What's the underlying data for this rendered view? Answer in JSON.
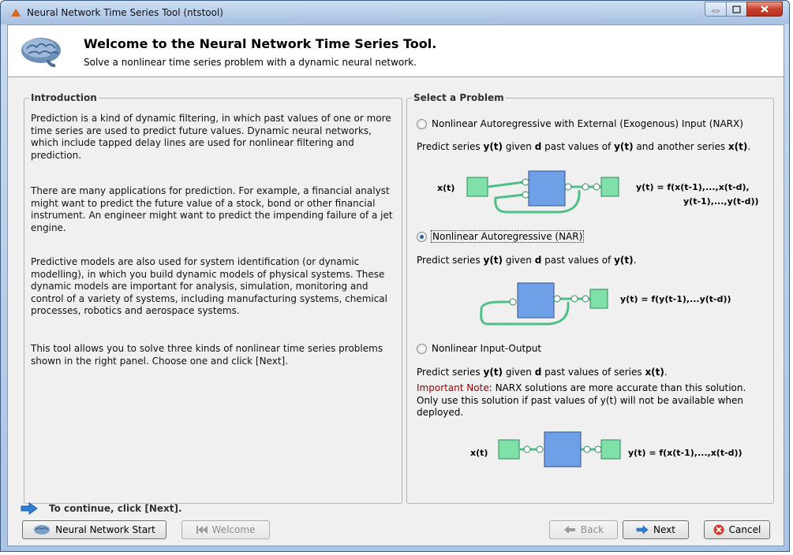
{
  "window": {
    "title": "Neural Network Time Series Tool (ntstool)"
  },
  "header": {
    "title": "Welcome to the Neural Network Time Series Tool.",
    "subtitle": "Solve a nonlinear time series problem with a dynamic neural network."
  },
  "introduction": {
    "label": "Introduction",
    "paragraphs": [
      "Prediction is a kind of dynamic filtering, in which past values of one or more time series are used to predict future values. Dynamic neural networks, which include tapped delay lines are used for nonlinear filtering and prediction.",
      "There are many applications for prediction. For example, a financial analyst might want to predict the future value of a stock, bond or other financial instrument. An engineer might want to predict the impending failure of a jet engine.",
      "Predictive models are also used for system identification (or dynamic modelling), in which you build dynamic models of physical systems. These dynamic models are important for analysis, simulation, monitoring and control of a variety of systems, including manufacturing systems, chemical processes, robotics and aerospace systems.",
      "This tool allows you to solve three kinds of nonlinear time series problems shown in the right panel. Choose one and click [Next]."
    ]
  },
  "problems": {
    "label": "Select a Problem",
    "narx": {
      "label": "Nonlinear Autoregressive with External (Exogenous) Input (NARX)",
      "selected": false,
      "pred_a": "Predict series ",
      "pred_b": "y(t)",
      "pred_c": " given ",
      "pred_d": "d",
      "pred_e": " past values of ",
      "pred_f": "y(t)",
      "pred_g": " and another series ",
      "pred_h": "x(t)",
      "pred_i": ".",
      "input": "x(t)",
      "formula_1": "y(t) = f(x(t-1),...,x(t-d),",
      "formula_2": "y(t-1),...,y(t-d))"
    },
    "nar": {
      "label": "Nonlinear Autoregressive (NAR)",
      "selected": true,
      "pred_a": "Predict series ",
      "pred_b": "y(t)",
      "pred_c": " given ",
      "pred_d": "d",
      "pred_e": " past values of ",
      "pred_f": "y(t)",
      "pred_g": ".",
      "formula": "y(t) = f(y(t-1),...y(t-d))"
    },
    "io": {
      "label": "Nonlinear Input-Output",
      "selected": false,
      "pred_a": "Predict series ",
      "pred_b": "y(t)",
      "pred_c": " given ",
      "pred_d": "d",
      "pred_e": " past values of series ",
      "pred_f": "x(t)",
      "pred_g": ".",
      "note_label": "Important Note",
      "note_text": ": NARX solutions are more accurate than this solution. Only use this solution if past values of y(t) will not be available when deployed.",
      "input": "x(t)",
      "formula": "y(t) = f(x(t-1),...,x(t-d))"
    }
  },
  "footer": {
    "continue_text": "To continue, click [Next].",
    "nn_start": "Neural Network Start",
    "welcome": "Welcome",
    "back": "Back",
    "next": "Next",
    "cancel": "Cancel"
  },
  "colors": {
    "node": "#6ea0e8",
    "io_box": "#7fe0a8",
    "link": "#4fbf88",
    "note_red": "#a00000",
    "arrow_blue": "#2f7fd8"
  }
}
